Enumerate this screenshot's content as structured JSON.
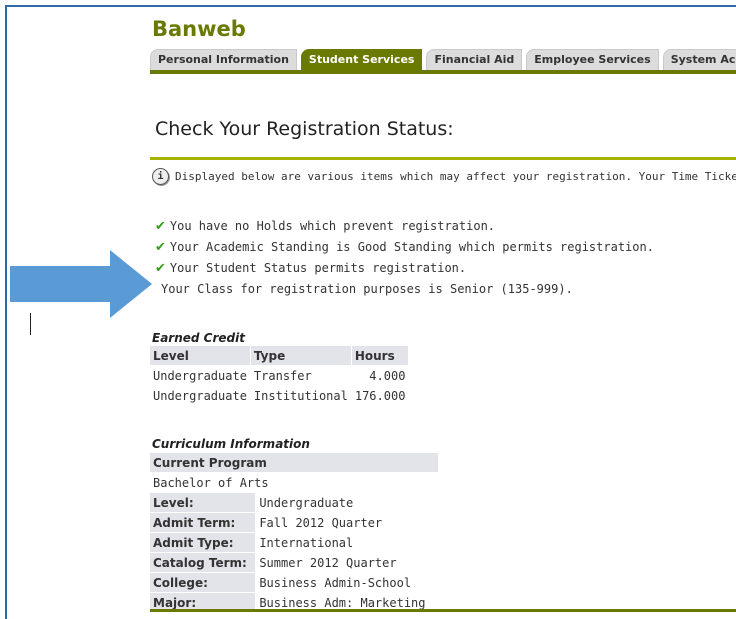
{
  "app": {
    "brand": "Banweb"
  },
  "tabs": [
    {
      "label": "Personal Information",
      "active": false
    },
    {
      "label": "Student Services",
      "active": true
    },
    {
      "label": "Financial Aid",
      "active": false
    },
    {
      "label": "Employee Services",
      "active": false
    },
    {
      "label": "System Access",
      "active": false
    }
  ],
  "page": {
    "title": "Check Your Registration Status:",
    "info_text": "Displayed below are various items which may affect your registration. Your Time Ticket,"
  },
  "status_messages": [
    {
      "text": "You have no Holds which prevent registration.",
      "icon": "checkmark-icon"
    },
    {
      "text": "Your Academic Standing is Good Standing which permits registration.",
      "icon": "checkmark-icon"
    },
    {
      "text": "Your Student Status permits registration.",
      "icon": "checkmark-icon"
    },
    {
      "text": "Your Class for registration purposes is Senior (135-999).",
      "icon": null
    }
  ],
  "earned_credit": {
    "title": "Earned Credit",
    "headers": [
      "Level",
      "Type",
      "Hours"
    ],
    "rows": [
      [
        "Undergraduate",
        "Transfer",
        "4.000"
      ],
      [
        "Undergraduate",
        "Institutional",
        "176.000"
      ]
    ]
  },
  "curriculum": {
    "title": "Curriculum Information",
    "program_header": "Current Program",
    "program": "Bachelor of Arts",
    "fields": [
      {
        "label": "Level:",
        "value": "Undergraduate"
      },
      {
        "label": "Admit Term:",
        "value": "Fall 2012 Quarter"
      },
      {
        "label": "Admit Type:",
        "value": "International"
      },
      {
        "label": "Catalog Term:",
        "value": "Summer 2012 Quarter"
      },
      {
        "label": "College:",
        "value": "Business Admin-School"
      },
      {
        "label": "Major:",
        "value": "Business Adm: Marketing"
      }
    ]
  },
  "colors": {
    "brand": "#6a7a00",
    "arrow": "#5b9bd5",
    "check": "#3a9a1f",
    "frame": "#2e6aa8"
  }
}
